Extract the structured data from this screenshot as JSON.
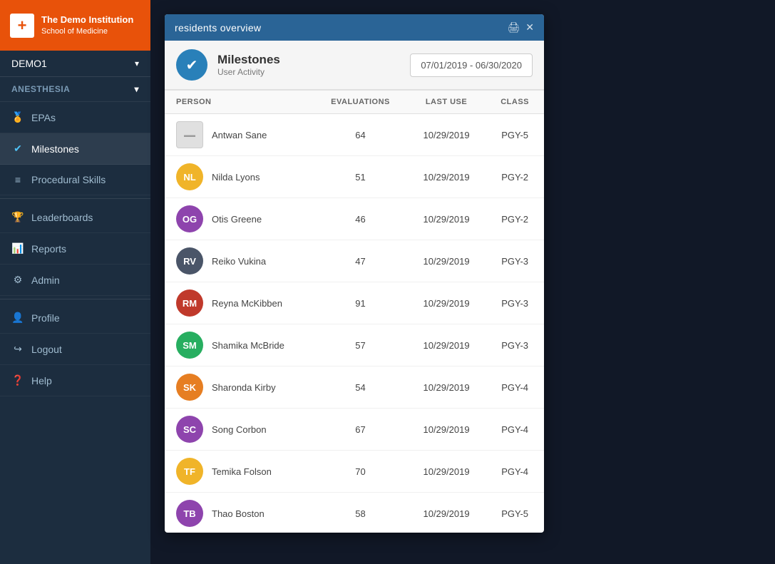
{
  "app": {
    "institution_line1": "The Demo Institution",
    "institution_line2": "School of Medicine"
  },
  "sidebar": {
    "user": "DEMO1",
    "department": "ANESTHESIA",
    "nav_items": [
      {
        "id": "epas",
        "label": "EPAs",
        "icon": "🏅",
        "active": false
      },
      {
        "id": "milestones",
        "label": "Milestones",
        "icon": "✔",
        "active": true
      },
      {
        "id": "procedural-skills",
        "label": "Procedural Skills",
        "icon": "☰",
        "active": false
      },
      {
        "id": "leaderboards",
        "label": "Leaderboards",
        "icon": "🏆",
        "active": false
      },
      {
        "id": "reports",
        "label": "Reports",
        "icon": "📊",
        "active": false
      },
      {
        "id": "admin",
        "label": "Admin",
        "icon": "⚙",
        "active": false
      },
      {
        "id": "profile",
        "label": "Profile",
        "icon": "👤",
        "active": false
      },
      {
        "id": "logout",
        "label": "Logout",
        "icon": "⬚",
        "active": false
      },
      {
        "id": "help",
        "label": "Help",
        "icon": "❓",
        "active": false
      }
    ]
  },
  "panel": {
    "title": "residents overview",
    "print_icon": "🖨",
    "close_icon": "✕",
    "module_name": "Milestones",
    "module_sub": "User Activity",
    "date_range": "07/01/2019 - 06/30/2020",
    "columns": {
      "person": "PERSON",
      "evaluations": "EVALUATIONS",
      "last_use": "LAST USE",
      "class": "CLASS"
    },
    "rows": [
      {
        "initials": null,
        "img": true,
        "name": "Antwan Sane",
        "evaluations": 64,
        "last_use": "10/29/2019",
        "class": "PGY-5",
        "color": "#c00"
      },
      {
        "initials": "NL",
        "name": "Nilda Lyons",
        "evaluations": 51,
        "last_use": "10/29/2019",
        "class": "PGY-2",
        "color": "#f0b429"
      },
      {
        "initials": "OG",
        "name": "Otis Greene",
        "evaluations": 46,
        "last_use": "10/29/2019",
        "class": "PGY-2",
        "color": "#8e44ad"
      },
      {
        "initials": "RV",
        "name": "Reiko Vukina",
        "evaluations": 47,
        "last_use": "10/29/2019",
        "class": "PGY-3",
        "color": "#4a5568"
      },
      {
        "initials": "RM",
        "name": "Reyna McKibben",
        "evaluations": 91,
        "last_use": "10/29/2019",
        "class": "PGY-3",
        "color": "#c0392b"
      },
      {
        "initials": "SM",
        "name": "Shamika McBride",
        "evaluations": 57,
        "last_use": "10/29/2019",
        "class": "PGY-3",
        "color": "#27ae60"
      },
      {
        "initials": "SK",
        "name": "Sharonda Kirby",
        "evaluations": 54,
        "last_use": "10/29/2019",
        "class": "PGY-4",
        "color": "#e67e22"
      },
      {
        "initials": "SC",
        "name": "Song Corbon",
        "evaluations": 67,
        "last_use": "10/29/2019",
        "class": "PGY-4",
        "color": "#8e44ad"
      },
      {
        "initials": "TF",
        "name": "Temika Folson",
        "evaluations": 70,
        "last_use": "10/29/2019",
        "class": "PGY-4",
        "color": "#f0b429"
      },
      {
        "initials": "TB",
        "name": "Thao Boston",
        "evaluations": 58,
        "last_use": "10/29/2019",
        "class": "PGY-5",
        "color": "#8e44ad"
      }
    ]
  }
}
